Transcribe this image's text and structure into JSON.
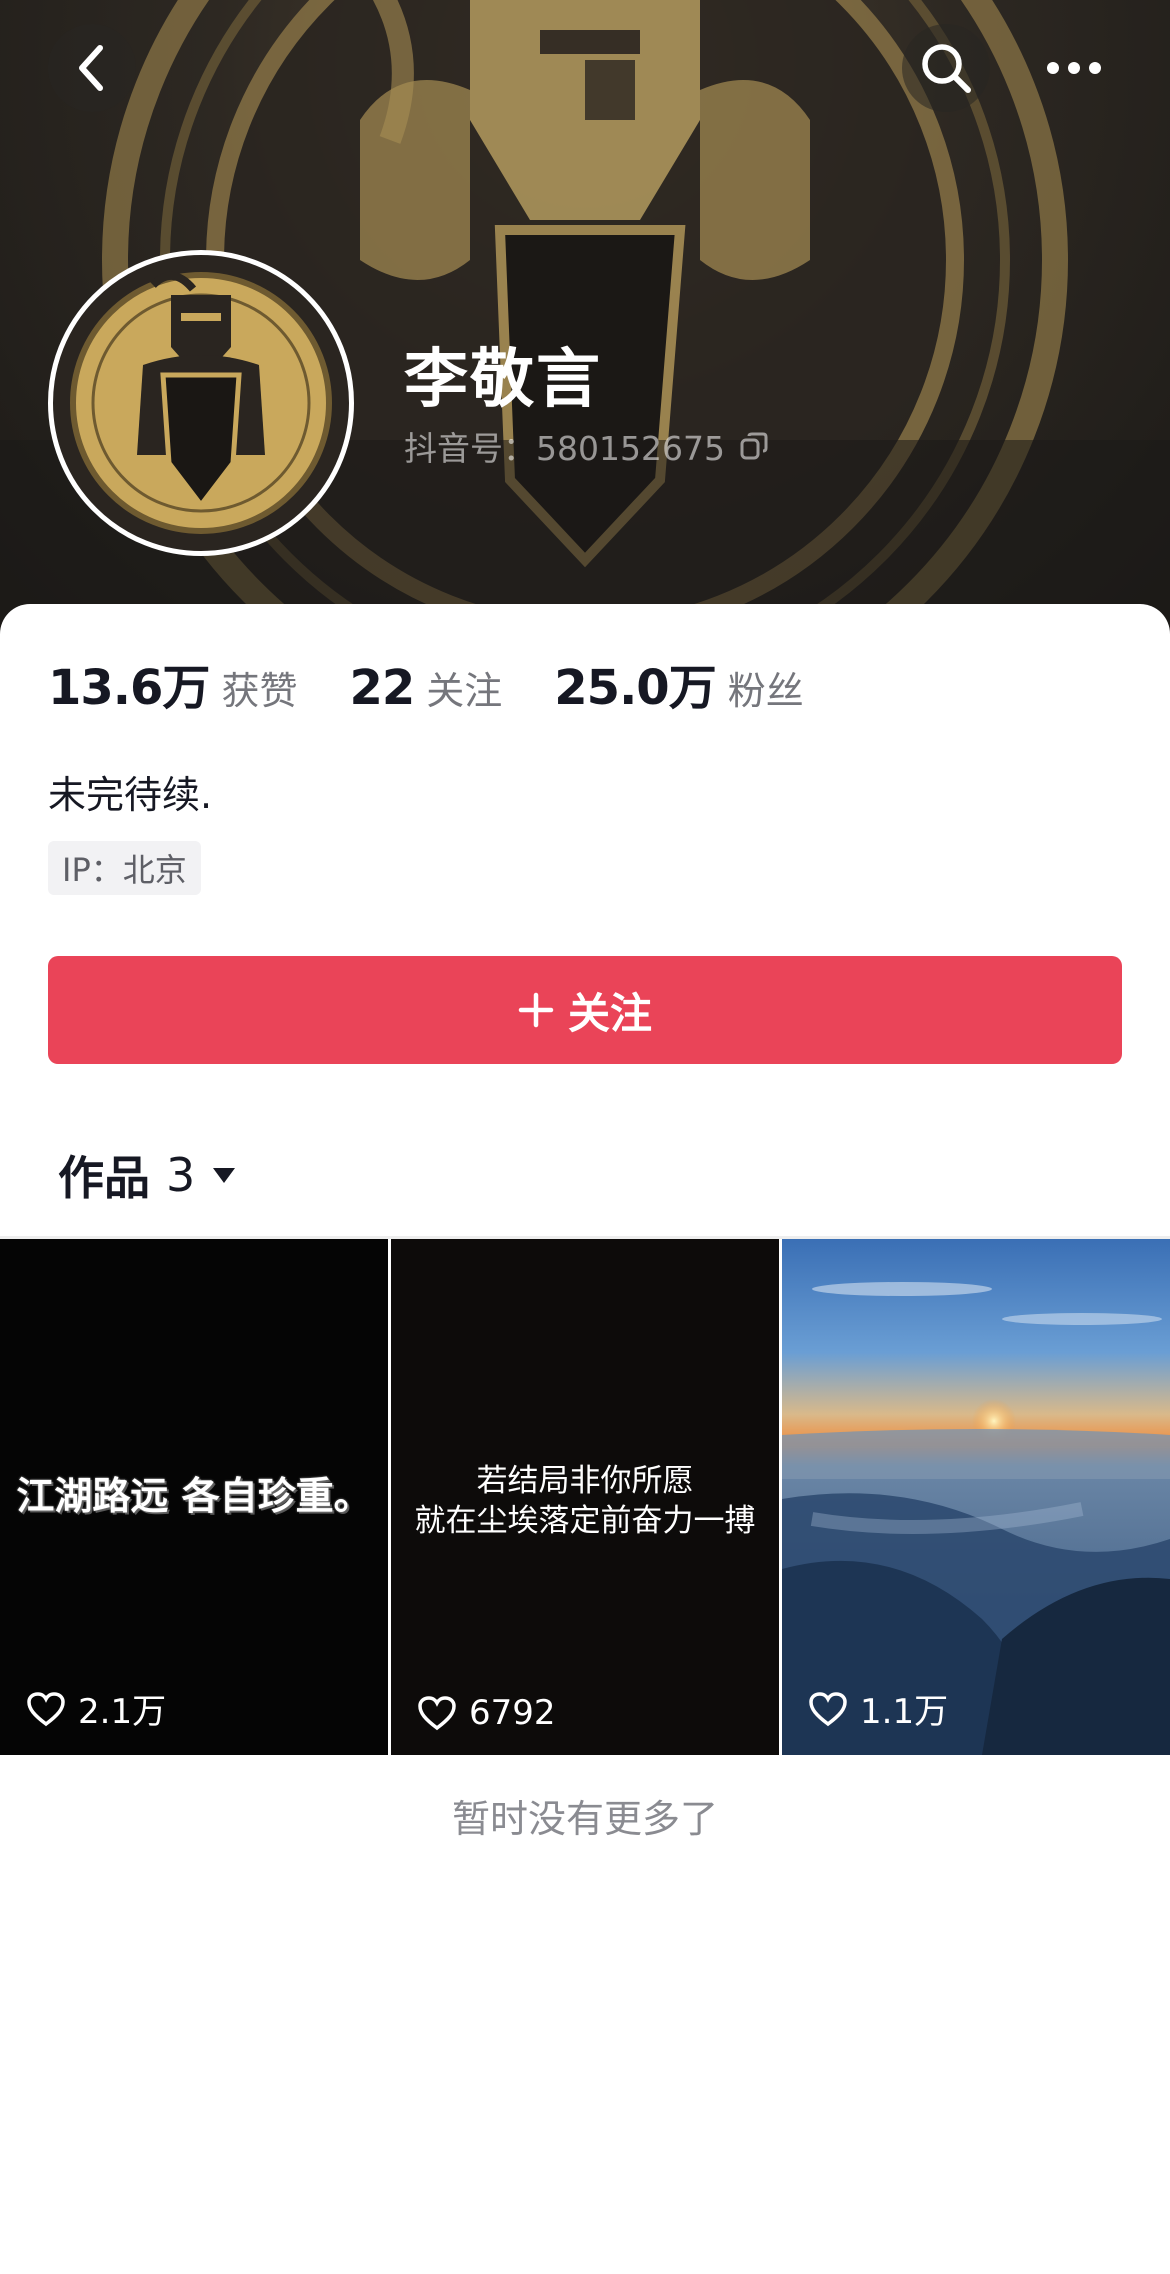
{
  "header": {
    "name": "李敬言",
    "douyin_id": "抖音号：580152675",
    "icons": [
      "back-icon",
      "search-icon",
      "more-icon",
      "copy-icon"
    ]
  },
  "stats": [
    {
      "value": "13.6万",
      "label": "获赞"
    },
    {
      "value": "22",
      "label": "关注"
    },
    {
      "value": "25.0万",
      "label": "粉丝"
    }
  ],
  "bio": "未完待续.",
  "ip": "IP：北京",
  "follow_button": {
    "label": "关注"
  },
  "works": {
    "label": "作品",
    "count": "3"
  },
  "videos": [
    {
      "overlay_line1": "江湖路远 各自珍重。",
      "overlay_line2": "",
      "likes": "2.1万"
    },
    {
      "overlay_line1": "若结局非你所愿",
      "overlay_line2": "就在尘埃落定前奋力一搏",
      "likes": "6792"
    },
    {
      "overlay_line1": "",
      "overlay_line2": "",
      "likes": "1.1万"
    }
  ],
  "footer": {
    "no_more": "暂时没有更多了"
  },
  "colors": {
    "accent": "#ea4458",
    "gold": "#c9a85c",
    "text": "#161823",
    "muted": "#75767c"
  }
}
